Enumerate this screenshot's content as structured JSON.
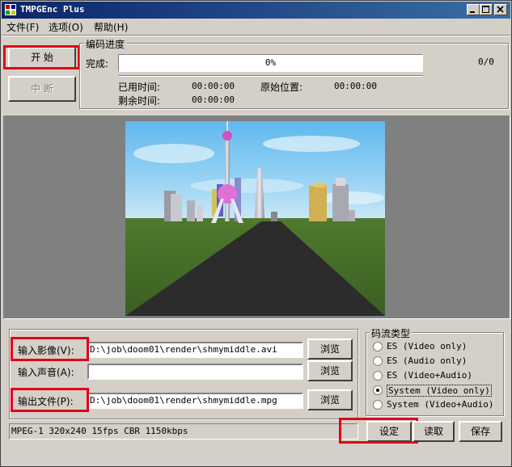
{
  "window": {
    "title": "TMPGEnc Plus"
  },
  "menu": [
    {
      "label": "文件(F)"
    },
    {
      "label": "选项(O)"
    },
    {
      "label": "帮助(H)"
    }
  ],
  "controls": {
    "start": "开 始",
    "abort": "中 断"
  },
  "progress": {
    "group_label": "编码进度",
    "complete_label": "完成:",
    "percent_text": "0%",
    "percent_value": 0,
    "frame_count": "0/0",
    "elapsed_label": "已用时间:",
    "elapsed_value": "00:00:00",
    "remaining_label": "剩余时间:",
    "remaining_value": "00:00:00",
    "source_pos_label": "原始位置:",
    "source_pos_value": "00:00:00"
  },
  "files": {
    "video_label": "输入影像(V):",
    "video_value": "D:\\job\\doom01\\render\\shmymiddle.avi",
    "audio_label": "输入声音(A):",
    "audio_value": "",
    "output_label": "输出文件(P):",
    "output_value": "D:\\job\\doom01\\render\\shmymiddle.mpg",
    "browse_label": "浏览"
  },
  "stream_type": {
    "group_label": "码流类型",
    "options": [
      {
        "label": "ES (Video only)",
        "checked": false
      },
      {
        "label": "ES (Audio only)",
        "checked": false
      },
      {
        "label": "ES (Video+Audio)",
        "checked": false
      },
      {
        "label": "System (Video only)",
        "checked": true
      },
      {
        "label": "System (Video+Audio)",
        "checked": false
      }
    ]
  },
  "status": {
    "info": "MPEG-1 320x240 15fps CBR 1150kbps"
  },
  "bottom_buttons": {
    "settings": "设定",
    "load": "读取",
    "save": "保存"
  },
  "colors": {
    "highlight": "#e0001a",
    "titlebar": "#0a246a",
    "face": "#d4d0c8"
  }
}
